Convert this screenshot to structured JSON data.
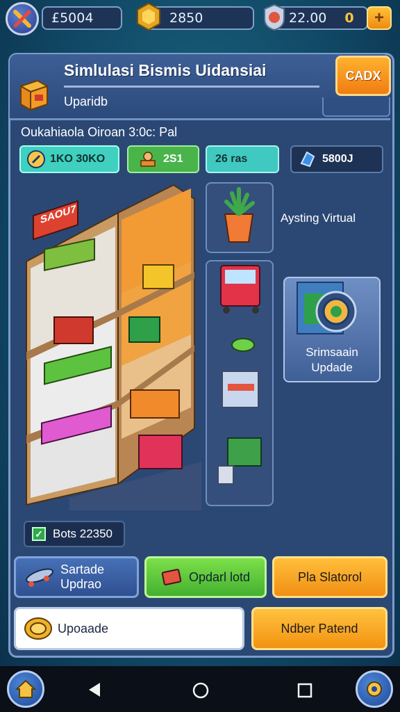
{
  "top_bar": {
    "resource_1": "£5004",
    "resource_2": "2850",
    "resource_3": "22.00",
    "resource_4": "0",
    "add_label": "+"
  },
  "panel": {
    "title": "Simlulasi Bismis Uidansiai",
    "subtitle": "Uparidb",
    "close_label": "CADX"
  },
  "status_line": "Oukahiaola Oiroan 3:0c: Pal",
  "stats": {
    "stat_1": "1KO 30KO",
    "stat_2": "2S1",
    "stat_3": "26 ras",
    "stat_4": "5800J"
  },
  "shelf_signs": {
    "sign_1": "SAOU7"
  },
  "side": {
    "virtual_label": "Aysting Virtual",
    "upgrade_card_label": "Srimsaain Updade"
  },
  "checkbox_label": "Bots 22350",
  "buttons": {
    "btn_1": "Sartade Updrao",
    "btn_2": "Opdarl lotd",
    "btn_3": "Pla Slatorol",
    "btn_4": "Upoaade",
    "btn_5": "Ndber Patend"
  },
  "colors": {
    "background": "#114b68",
    "panel": "#2b4875",
    "accent_orange": "#f18f15",
    "accent_green": "#44b030"
  }
}
